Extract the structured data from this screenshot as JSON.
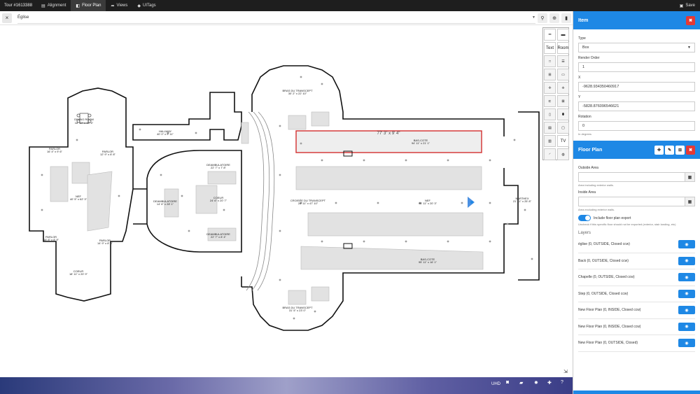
{
  "topbar": {
    "tour_label": "Tour #1613388",
    "tabs": [
      {
        "label": "Alignment",
        "icon": "alignment-icon"
      },
      {
        "label": "Floor Plan",
        "icon": "floorplan-icon",
        "active": true
      },
      {
        "label": "Views",
        "icon": "share-icon"
      },
      {
        "label": "UITags",
        "icon": "tag-icon"
      }
    ],
    "save_label": "Save"
  },
  "subbar": {
    "close_glyph": "×",
    "floor_name": "Église"
  },
  "palette": {
    "text_tool": "Text",
    "tv_tool": "TV",
    "room_tool": "Room"
  },
  "bottombar": {
    "uhd_label": "UHD"
  },
  "plan": {
    "rooms": [
      {
        "name": "DINING ROOM",
        "dims": "18' 10\" x 16' 6\""
      },
      {
        "name": "HALLWAY",
        "dims": "40' 0\" x 9' 11\""
      },
      {
        "name": "PARLOR",
        "dims": "16' 4\" x 9' 6\""
      },
      {
        "name": "PARLOR",
        "dims": "12' 9\" x 8' 8\""
      },
      {
        "name": "NEF",
        "dims": "40' 5\" x 62' 3\""
      },
      {
        "name": "PARLOR",
        "dims": "16' 8\" x 8' 9\""
      },
      {
        "name": "PARLOR",
        "dims": "14' 9\" x 8' 8\""
      },
      {
        "name": "COEUR",
        "dims": "18' 11\" x 20' 9\""
      },
      {
        "name": "DEAMBULATOIRE",
        "dims": "22' 7\" x 7' 8\""
      },
      {
        "name": "DEAMBULATOIRE",
        "dims": "14' 6\" x 28' 1\""
      },
      {
        "name": "COEUR",
        "dims": "24' 6\" x 20' 7\""
      },
      {
        "name": "DEAMBULATOIRE",
        "dims": "22' 7\" x 8' 4\""
      },
      {
        "name": "BRAS DU TRANSCEPT",
        "dims": "30' 2\" x 22' 10\""
      },
      {
        "name": "BAS-COTE",
        "dims": "94' 11\" x 21' 1\""
      },
      {
        "name": "CROISÉE DU TRANSCEPT",
        "dims": "28' 11\" x 47' 10\""
      },
      {
        "name": "NEF",
        "dims": "98' 11\" x 20' 3\""
      },
      {
        "name": "NARTHEX",
        "dims": "21' 11\" x 25' 8\""
      },
      {
        "name": "BAS-COTE",
        "dims": "95' 11\" x 16' 1\""
      },
      {
        "name": "BRAS DU TRANSCEPT",
        "dims": "31' 5\" x 23' 0\""
      }
    ],
    "selected_dims": "77' 3\" x 9' 4\""
  },
  "panel": {
    "item_title": "Item",
    "type_label": "Type",
    "type_value": "Box",
    "render_order_label": "Render Order",
    "render_order_value": "1",
    "x_label": "X",
    "x_value": "-9628.934350460917",
    "y_label": "Y",
    "y_value": "-5828.876096546621",
    "rotation_label": "Rotation",
    "rotation_value": "0",
    "rotation_hint": "In degrees",
    "floorplan_title": "Floor Plan",
    "outside_area_label": "Outside Area",
    "outside_area_hint": "Area including exterior walls.",
    "inside_area_label": "Inside Area",
    "inside_area_hint": "Area excluding exterior walls.",
    "include_export_label": "Include floor plan export",
    "include_export_hint": "Uncheck if this specific floor should not be exported (exterior, stair landing, etc)",
    "layers_title": "Layers",
    "layers": [
      "église (0, OUTSIDE, Closed ccw)",
      "Back (0, OUTSIDE, Closed ccw)",
      "Chapelle (0, OUTSIDE, Closed ccw)",
      "Step (0, OUTSIDE, Closed ccw)",
      "New Floor Plan (0, INSIDE, Closed ccw)",
      "New Floor Plan (0, INSIDE, Closed ccw)",
      "New Floor Plan (0, OUTSIDE, Closed)"
    ]
  },
  "colors": {
    "accent": "#1e88e5",
    "danger": "#e53935",
    "topbar": "#1e1e1e",
    "selection": "#d32f2f"
  }
}
